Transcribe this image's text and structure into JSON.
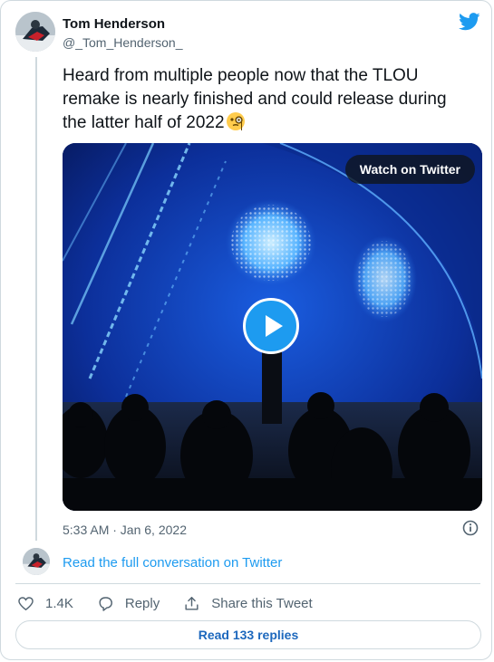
{
  "author": {
    "name": "Tom Henderson",
    "handle": "@_Tom_Henderson_"
  },
  "tweet": {
    "text": "Heard from multiple people now that the TLOU remake is nearly finished and could release during the latter half of 2022",
    "emoji": "face-with-monocle",
    "timestamp": "5:33 AM · Jan 6, 2022"
  },
  "media": {
    "watch_label": "Watch on Twitter"
  },
  "conversation": {
    "link_label": "Read the full conversation on Twitter"
  },
  "actions": {
    "likes": "1.4K",
    "reply_label": "Reply",
    "share_label": "Share this Tweet"
  },
  "replies": {
    "label": "Read 133 replies"
  },
  "colors": {
    "accent": "#1d9bf0",
    "secondary_text": "#536471",
    "border": "#cfd9de"
  }
}
